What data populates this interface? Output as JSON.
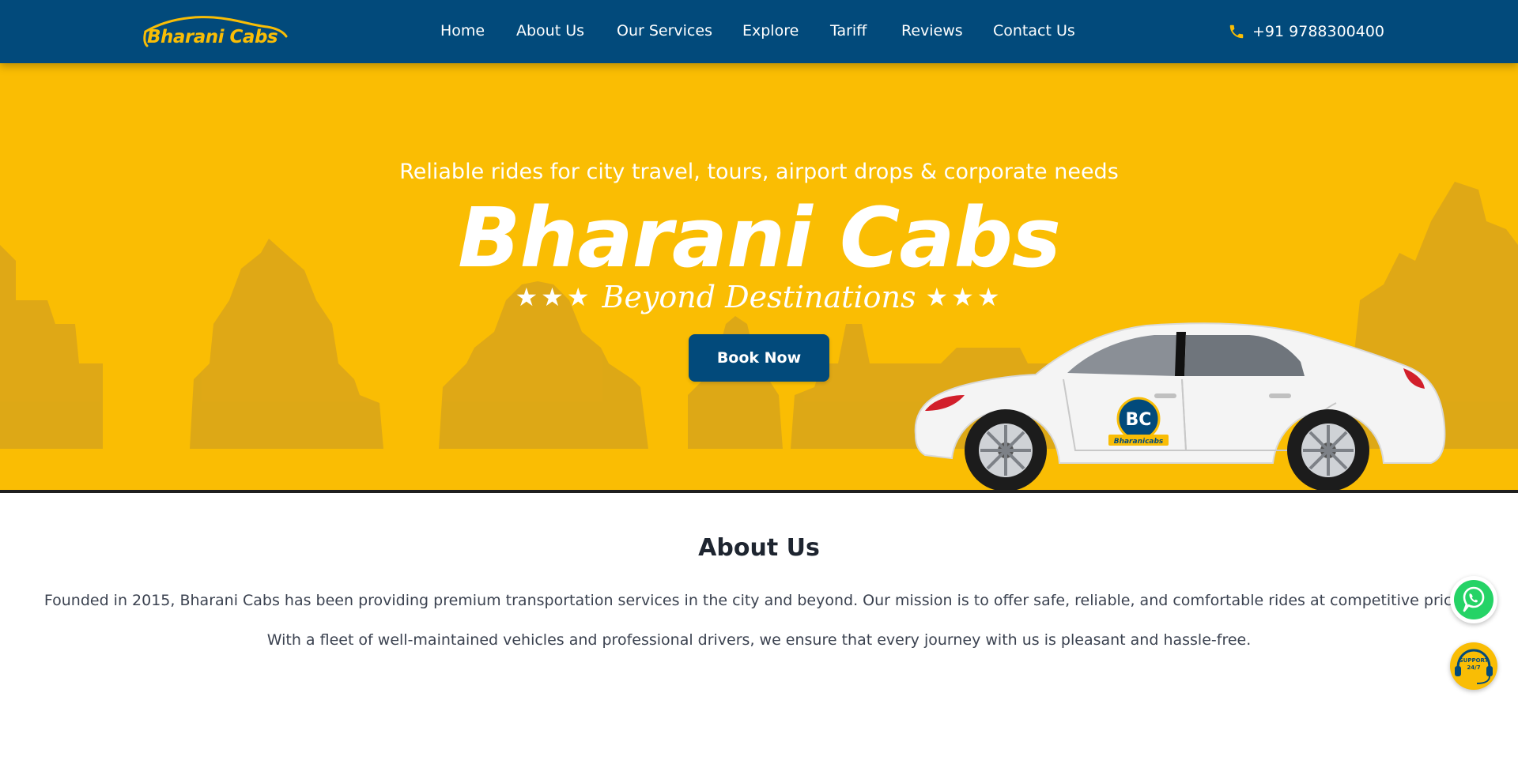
{
  "header": {
    "logo_text": "Bharani Cabs",
    "nav": [
      {
        "label": "Home"
      },
      {
        "label": "About Us"
      },
      {
        "label": "Our Services"
      },
      {
        "label": "Explore"
      },
      {
        "label": "Tariff"
      },
      {
        "label": "Reviews"
      },
      {
        "label": "Contact Us"
      }
    ],
    "phone": "+91 9788300400",
    "phone_icon": "phone-icon"
  },
  "hero": {
    "subtitle": "Reliable rides for city travel, tours, airport drops & corporate needs",
    "title": "Bharani Cabs",
    "stars_left": "★★★",
    "tagline": "Beyond Destinations",
    "stars_right": "★★★",
    "book_button": "Book Now",
    "car_logo_letters": "BC",
    "car_logo_word": "Bharanicabs"
  },
  "about": {
    "title": "About Us",
    "p1": "Founded in 2015, Bharani Cabs has been providing premium transportation services in the city and beyond. Our mission is to offer safe, reliable, and comfortable rides at competitive prices.",
    "p2": "With a fleet of well-maintained vehicles and professional drivers, we ensure that every journey with us is pleasant and hassle-free."
  },
  "floating": {
    "whatsapp_icon": "whatsapp-icon",
    "support_line1": "SUPPORT",
    "support_line2": "24/7"
  },
  "colors": {
    "header_bg": "#024a7b",
    "hero_bg": "#fabd03",
    "accent": "#f9bd05",
    "whatsapp_green": "#25d366"
  }
}
